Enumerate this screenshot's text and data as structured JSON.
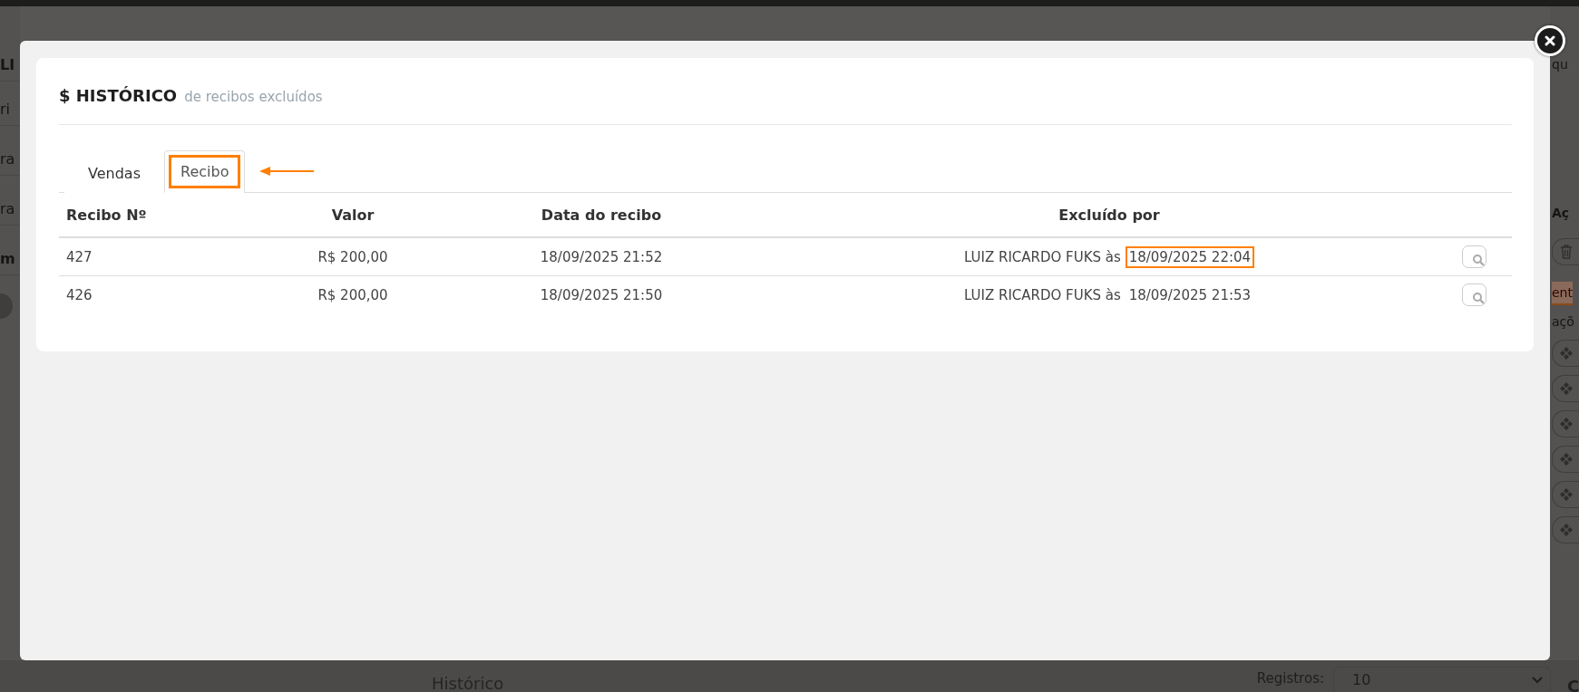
{
  "background": {
    "left_items": [
      {
        "kind": "bold",
        "text": "LI"
      },
      {
        "kind": "text",
        "text": "ri"
      },
      {
        "kind": "text",
        "text": "ra"
      },
      {
        "kind": "text",
        "text": "ra"
      },
      {
        "kind": "bold",
        "text": "m"
      },
      {
        "kind": "avatar"
      }
    ],
    "right_items": [
      {
        "kind": "text",
        "text": "qu"
      },
      {
        "kind": "heading",
        "text": "Aç"
      },
      {
        "kind": "trash"
      },
      {
        "kind": "alert",
        "text": "ent"
      },
      {
        "kind": "text",
        "text": "açõ"
      },
      {
        "kind": "action"
      },
      {
        "kind": "action"
      },
      {
        "kind": "action"
      },
      {
        "kind": "action"
      },
      {
        "kind": "action"
      },
      {
        "kind": "action"
      }
    ],
    "footer": {
      "title": "Histórico",
      "page_size_label": "Registros:",
      "page_size": "10",
      "edge_text": "C"
    }
  },
  "modal": {
    "title": "$ HISTÓRICO",
    "subtitle": "de recibos excluídos",
    "tabs": [
      {
        "label": "Vendas",
        "selected": false,
        "highlighted": false
      },
      {
        "label": "Recibo",
        "selected": true,
        "highlighted": true
      }
    ],
    "table": {
      "columns": [
        "Recibo Nº",
        "Valor",
        "Data do recibo",
        "Excluído por"
      ],
      "rows": [
        {
          "number": "427",
          "value": "R$ 200,00",
          "date": "18/09/2025 21:52",
          "excluded_by": "LUIZ RICARDO FUKS às",
          "excluded_at": "18/09/2025 22:04",
          "highlighted": true
        },
        {
          "number": "426",
          "value": "R$ 200,00",
          "date": "18/09/2025 21:50",
          "excluded_by": "LUIZ RICARDO FUKS às",
          "excluded_at": "18/09/2025 21:53",
          "highlighted": false
        }
      ]
    }
  }
}
